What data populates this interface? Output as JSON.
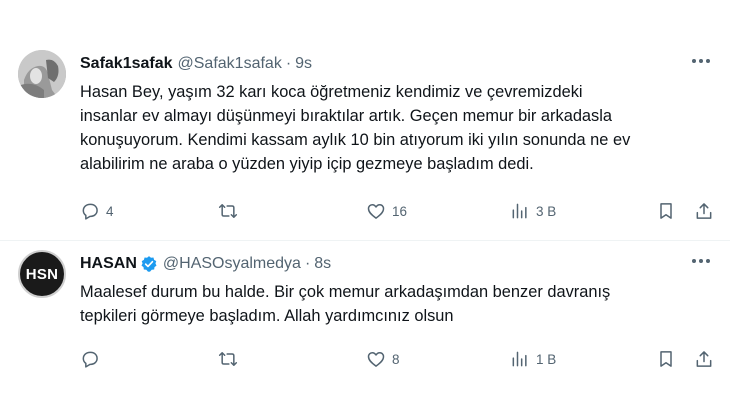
{
  "tweets": [
    {
      "author": "Safak1safak",
      "handle": "@Safak1safak",
      "separator": "·",
      "time": "9s",
      "verified": false,
      "text": "Hasan Bey, yaşım 32 karı koca öğretmeniz kendimiz ve çevremizdeki\ninsanlar ev almayı düşünmeyi bıraktılar artık. Geçen memur bir arkadasla\nkonuşuyorum. Kendimi kassam aylık 10 bin atıyorum iki yılın sonunda ne ev\nalabilirim ne araba o yüzden yiyip içip gezmeye başladım dedi.",
      "stats": {
        "replies": "4",
        "retweets": "",
        "likes": "16",
        "views": "3 B"
      }
    },
    {
      "author": "HASAN",
      "handle": "@HASOsyalmedya",
      "separator": "·",
      "time": "8s",
      "verified": true,
      "avatar_text": "HSN",
      "text": "Maalesef durum bu halde. Bir çok memur arkadaşımdan benzer davranış\ntepkileri görmeye başladım. Allah yardımcınız olsun",
      "stats": {
        "replies": "",
        "retweets": "",
        "likes": "8",
        "views": "1 B"
      }
    }
  ],
  "colors": {
    "text": "#0f1419",
    "muted": "#536471",
    "verified": "#1d9bf0",
    "divider": "#eff3f4"
  },
  "icons": [
    "reply-icon",
    "retweet-icon",
    "like-icon",
    "views-icon",
    "bookmark-icon",
    "share-icon",
    "more-icon",
    "verified-icon"
  ]
}
